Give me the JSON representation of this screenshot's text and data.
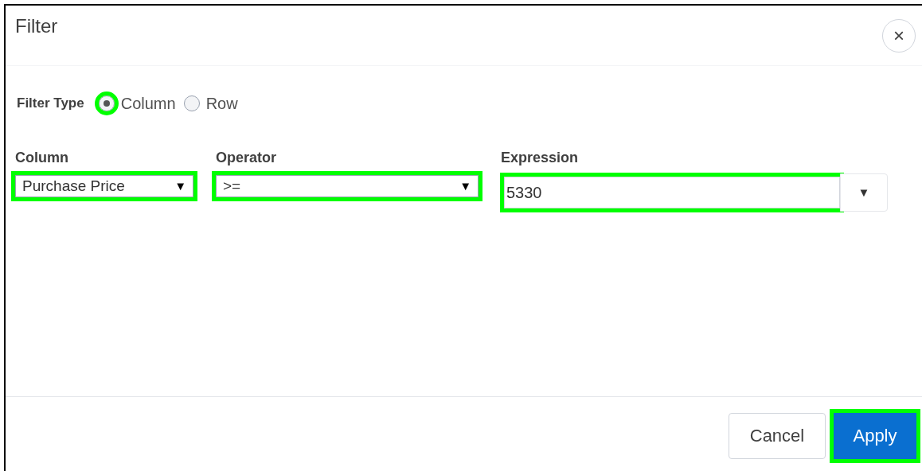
{
  "dialog": {
    "title": "Filter",
    "close_label": "×"
  },
  "filter_type": {
    "label": "Filter Type",
    "options": [
      {
        "label": "Column",
        "selected": true,
        "highlighted": true
      },
      {
        "label": "Row",
        "selected": false,
        "highlighted": false
      }
    ]
  },
  "fields": [
    {
      "kind": "select",
      "label": "Column",
      "value": "Purchase Price",
      "arrow": "▼",
      "highlighted": true
    },
    {
      "kind": "select",
      "label": "Operator",
      "value": ">=",
      "arrow": "▼",
      "highlighted": true
    },
    {
      "kind": "combo",
      "label": "Expression",
      "value": "5330",
      "arrow": "▼",
      "highlighted": true
    }
  ],
  "buttons": [
    {
      "kind": "secondary",
      "label": "Cancel",
      "highlighted": false
    },
    {
      "kind": "primary",
      "label": "Apply",
      "highlighted": true
    }
  ]
}
